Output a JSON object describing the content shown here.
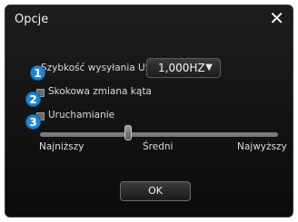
{
  "window": {
    "title": "Opcje",
    "close_glyph": "✕"
  },
  "usb": {
    "label": "Szybkość wysyłania USB",
    "selected": "1,000HZ",
    "arrow_glyph": "▼"
  },
  "angle_snapping": {
    "label": "Skokowa zmiana kąta",
    "checked": false
  },
  "launch": {
    "label": "Uruchamianie",
    "checked": false
  },
  "slider": {
    "min_label": "Najniższy",
    "mid_label": "Średni",
    "max_label": "Najwyższy",
    "value_fraction": 0.36
  },
  "badges": [
    "1",
    "2",
    "3"
  ],
  "footer": {
    "ok_label": "OK"
  },
  "colors": {
    "badge": "#1f86d6",
    "background": "#0f0f10"
  }
}
